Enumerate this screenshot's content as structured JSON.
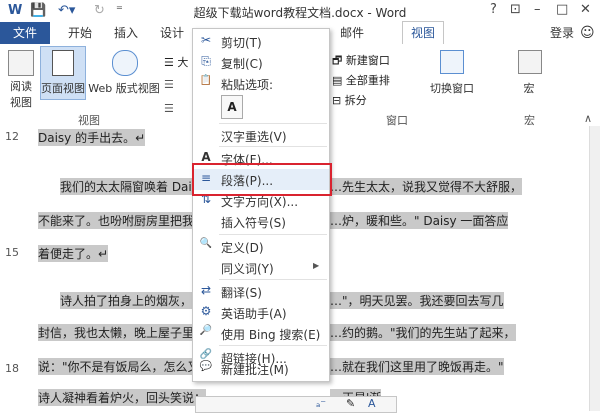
{
  "titlebar": {
    "doc_title": "超级下载站word教程文档.docx - Word",
    "help": "?"
  },
  "tabs": {
    "file": "文件",
    "home": "开始",
    "insert": "插入",
    "design": "设计",
    "mailings": "邮件",
    "view": "视图",
    "login": "登录"
  },
  "ribbon": {
    "read_mode": "阅读视图",
    "print_layout": "页面视图",
    "web_layout": "Web 版式视图",
    "views_group": "视图",
    "partial_da": "大",
    "new_window": "新建窗口",
    "arrange_all": "全部重排",
    "split": "拆分",
    "switch_windows": "切换窗口",
    "macros": "宏",
    "window_group": "窗口",
    "macros_group": "宏"
  },
  "document": {
    "lines": [
      {
        "num": "12",
        "text": "Daisy 的手出去。↵"
      },
      {
        "num": "",
        "text": "我们的太太隔窗唤着 Daisy"
      },
      {
        "num": "",
        "text": "不能来了。也吩咐厨房里把我们"
      },
      {
        "num": "15",
        "text": "着便走了。↵"
      },
      {
        "num": "",
        "text": "诗人拍了拍身上的烟灰，对"
      },
      {
        "num": "",
        "text": "封信，我也太懒，晚上屋子里又"
      },
      {
        "num": "",
        "text": "说：\"你不是有饭局么，怎么又到"
      },
      {
        "num": "18",
        "text": "诗人凝神看着炉火，回头笑说："
      }
    ],
    "right_fragments": [
      "…先生太太，说我又觉得不大舒服，",
      "…炉，暖和些。\" Daisy 一面答应",
      "…\"，明天见罢。我还要回去写几",
      "…约的鹅。\"我们的先生站了起来，",
      "…就在我们这里用了晚饭再走。\"",
      "…正是'渐"
    ]
  },
  "context_menu": {
    "items": [
      {
        "icon": "scissors-icon",
        "glyph": "✂",
        "label": "剪切(T)"
      },
      {
        "icon": "copy-icon",
        "glyph": "⎘",
        "label": "复制(C)"
      },
      {
        "icon": "paste-icon",
        "glyph": "📋",
        "label": "粘贴选项:"
      },
      {
        "icon": "paste-text-icon",
        "glyph": "A",
        "label": ""
      },
      {
        "icon": "",
        "glyph": "",
        "label": "汉字重选(V)"
      },
      {
        "icon": "font-icon",
        "glyph": "A",
        "label": "字体(F)..."
      },
      {
        "icon": "paragraph-icon",
        "glyph": "≡",
        "label": "段落(P)..."
      },
      {
        "icon": "text-direction-icon",
        "glyph": "⇅",
        "label": "文字方向(X)..."
      },
      {
        "icon": "",
        "glyph": "",
        "label": "插入符号(S)"
      },
      {
        "icon": "define-icon",
        "glyph": "🔍",
        "label": "定义(D)"
      },
      {
        "icon": "",
        "glyph": "",
        "label": "同义词(Y)"
      },
      {
        "icon": "translate-icon",
        "glyph": "⇄",
        "label": "翻译(S)"
      },
      {
        "icon": "english-assistant-icon",
        "glyph": "⚙",
        "label": "英语助手(A)"
      },
      {
        "icon": "bing-search-icon",
        "glyph": "🔎",
        "label": "使用 Bing 搜索(E)"
      },
      {
        "icon": "hyperlink-icon",
        "glyph": "🔗",
        "label": "超链接(H)..."
      },
      {
        "icon": "new-comment-icon",
        "glyph": "💬",
        "label": "新建批注(M)"
      }
    ],
    "submenu_arrow": "▶"
  },
  "accent_color": "#2b579a",
  "highlight_color": "#d9232f"
}
